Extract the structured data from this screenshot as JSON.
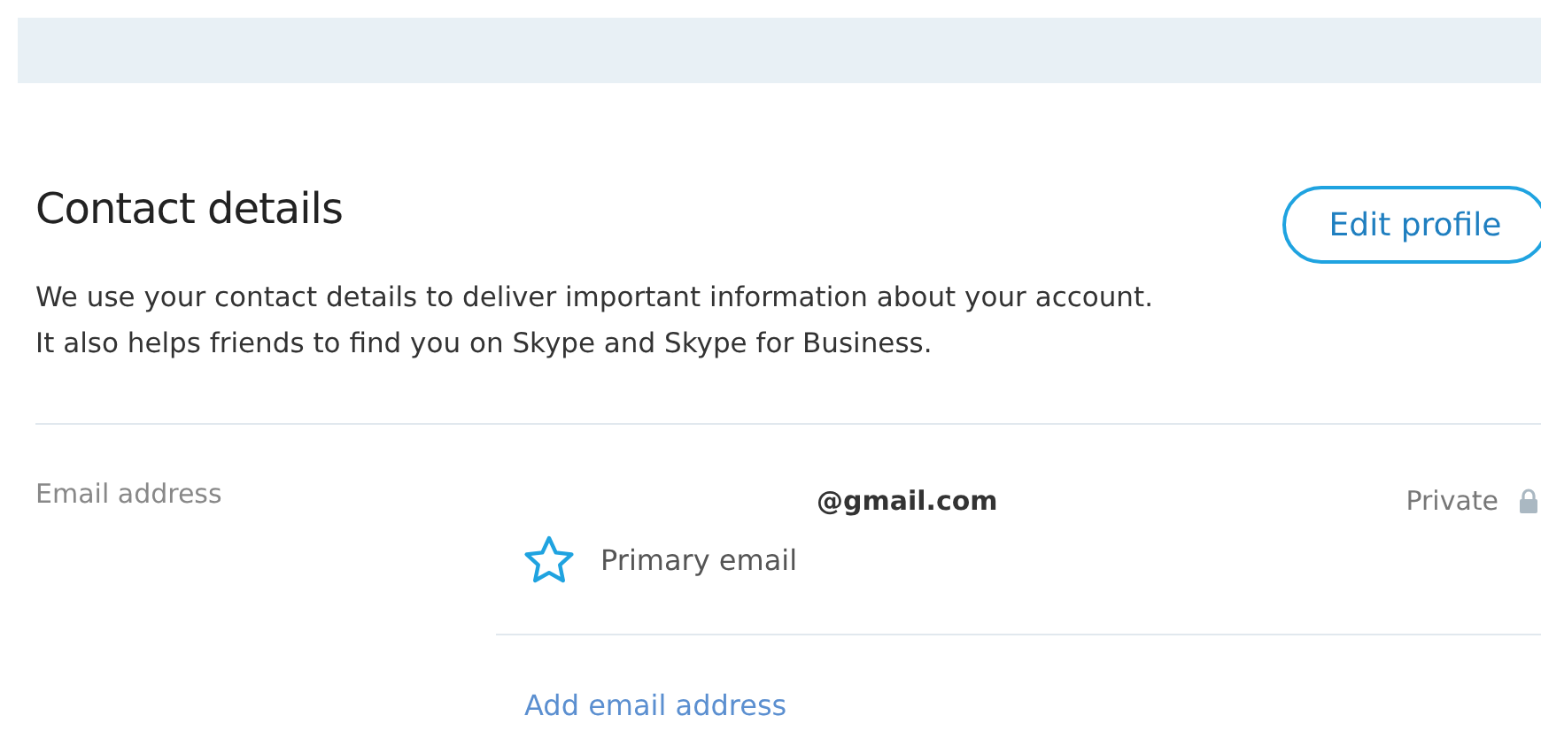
{
  "section": {
    "title": "Contact details",
    "edit_button": "Edit profile",
    "description": "We use your contact details to deliver important information about your account. It also helps friends to find you on Skype and Skype for Business."
  },
  "email": {
    "label": "Email address",
    "address": "@gmail.com",
    "visibility": "Private",
    "primary": true,
    "primary_label": "Primary email",
    "add_link": "Add email address"
  }
}
